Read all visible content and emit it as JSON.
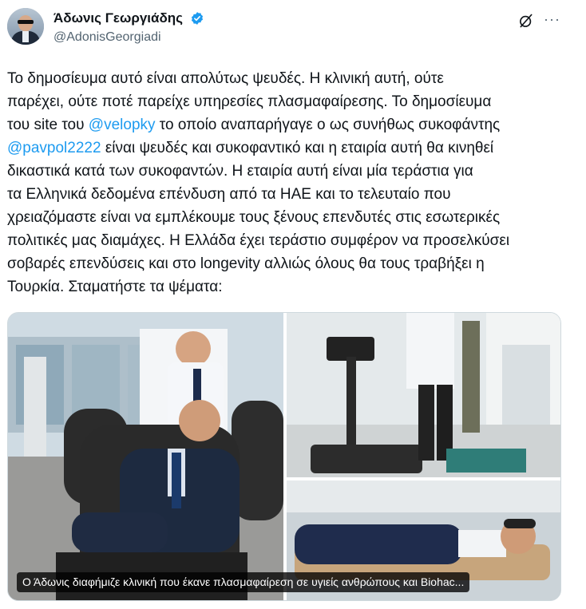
{
  "author": {
    "name": "Άδωνις Γεωργιάδης",
    "handle": "@AdonisGeorgiadi",
    "verified_color": "#1d9bf0"
  },
  "header": {
    "grok_icon": "grok-icon",
    "more_icon": "more-icon"
  },
  "tweet": {
    "line1": "Το δημοσίευμα αυτό είναι απολύτως ψευδές. Η κλινική αυτή, ούτε",
    "line2": "παρέχει, ούτε ποτέ παρείχε υπηρεσίες πλασμαφαίρεσης. Το δημοσίευμα",
    "line3_pre": "του site του ",
    "mention1": "@velopky",
    "line3_post": " το οποίο αναπαρήγαγε ο ως συνήθως συκοφάντης",
    "mention2": "@pavpol2222",
    "line4_post": " είναι ψευδές και συκοφαντικό και η εταιρία αυτή θα κινηθεί",
    "line5": "δικαστικά κατά των συκοφαντών. Η εταιρία αυτή είναι μία τεράστια για",
    "line6": "τα Ελληνικά δεδομένα επένδυση από τα ΗΑΕ και το τελευταίο που",
    "line7": "χρειαζόμαστε είναι να εμπλέκουμε τους ξένους επενδυτές στις εσωτερικές",
    "line8": "πολιτικές μας διαμάχες. Η Ελλάδα έχει τεράστιο συμφέρον να προσελκύσει",
    "line9": "σοβαρές επενδύσεις και στο longevity αλλιώς όλους θα τους τραβήξει η",
    "line10": "Τουρκία. Σταματήστε τα ψέματα:"
  },
  "media": {
    "caption": "Ο Άδωνις διαφήμιζε κλινική που έκανε πλασμαφαίρεση σε υγιείς ανθρώπους και Biohac..."
  },
  "colors": {
    "mention": "#1d9bf0",
    "text": "#0f1419",
    "secondary": "#536471"
  }
}
